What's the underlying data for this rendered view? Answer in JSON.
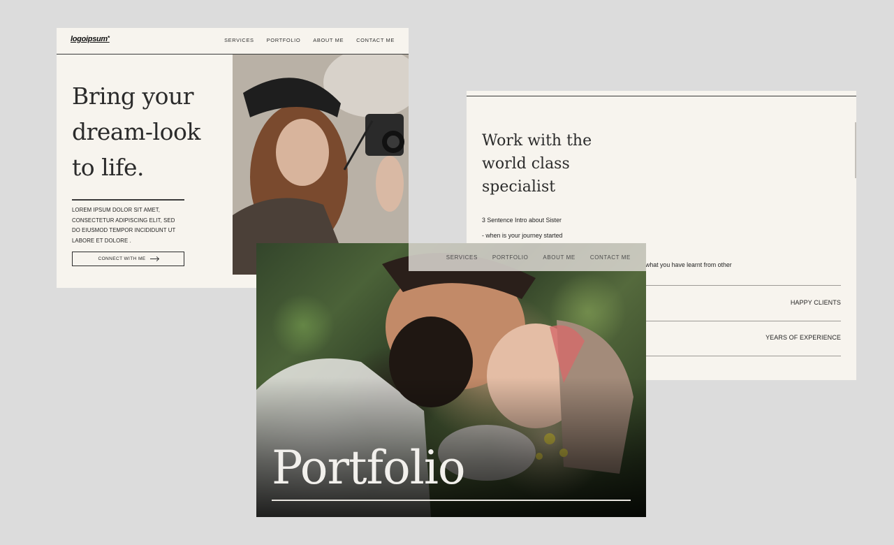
{
  "hero_card": {
    "logo": "logoipsum",
    "nav": [
      "SERVICES",
      "PORTFOLIO",
      "ABOUT ME",
      "CONTACT ME"
    ],
    "title_lines": [
      "Bring your",
      "dream-look",
      "to life."
    ],
    "body_lines": [
      "LOREM IPSUM DOLOR SIT AMET,",
      "CONSECTETUR ADIPISCING ELIT, SED",
      "DO EIUSMOD TEMPOR INCIDIDUNT UT",
      "LABORE ET DOLORE ."
    ],
    "button_label": "CONNECT WITH ME"
  },
  "about_card": {
    "title_lines": [
      "Work with the",
      "world class",
      "specialist"
    ],
    "intro_lines": [
      "3 Sentence Intro about Sister",
      "- when is your journey started",
      "what you have learnt from other"
    ],
    "stats": [
      "HAPPY CLIENTS",
      "YEARS OF EXPERIENCE"
    ]
  },
  "portfolio_card": {
    "nav": [
      "SERVICES",
      "PORTFOLIO",
      "ABOUT ME",
      "CONTACT ME"
    ],
    "title": "Portfolio"
  }
}
